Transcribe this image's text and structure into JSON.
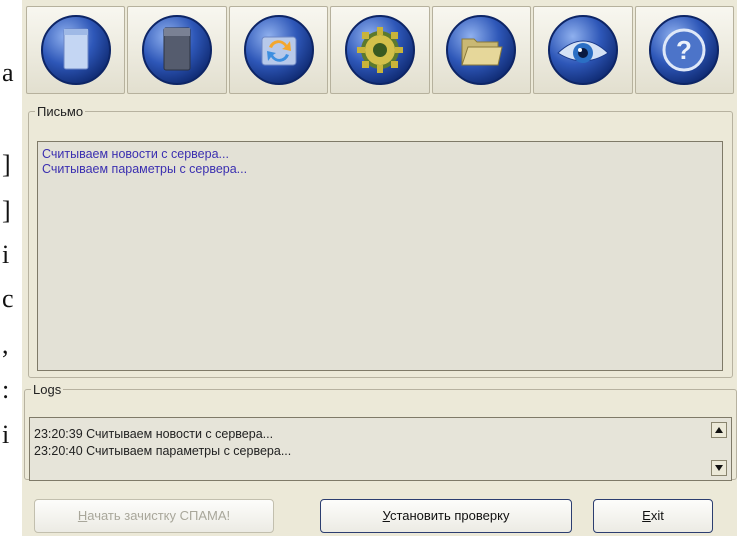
{
  "document_strip": {
    "chars": [
      "а",
      "]",
      "]",
      "і",
      "с",
      ",",
      ":",
      "і"
    ]
  },
  "toolbar": {
    "buttons": [
      {
        "icon": "blank-page-icon"
      },
      {
        "icon": "dark-page-icon"
      },
      {
        "icon": "refresh-arrows-icon"
      },
      {
        "icon": "gear-icon"
      },
      {
        "icon": "folder-icon"
      },
      {
        "icon": "eye-icon"
      },
      {
        "icon": "help-icon"
      }
    ]
  },
  "letters": {
    "legend": "Письмо",
    "lines": [
      "Считываем новости с сервера...",
      "Считываем параметры с сервера..."
    ]
  },
  "logs": {
    "legend": "Logs",
    "lines": [
      "23:20:39 Считываем новости с сервера...",
      "23:20:40 Считываем параметры с сервера..."
    ]
  },
  "buttons": {
    "start": {
      "first": "Н",
      "rest": "ачать зачистку СПАМА!"
    },
    "install": {
      "first": "У",
      "rest": "становить проверку"
    },
    "exit": {
      "first": "E",
      "rest": "xit"
    }
  },
  "colors": {
    "window_bg": "#ece9d8",
    "icon_blue": "#2e57b8",
    "message_text": "#3b2fb0"
  }
}
